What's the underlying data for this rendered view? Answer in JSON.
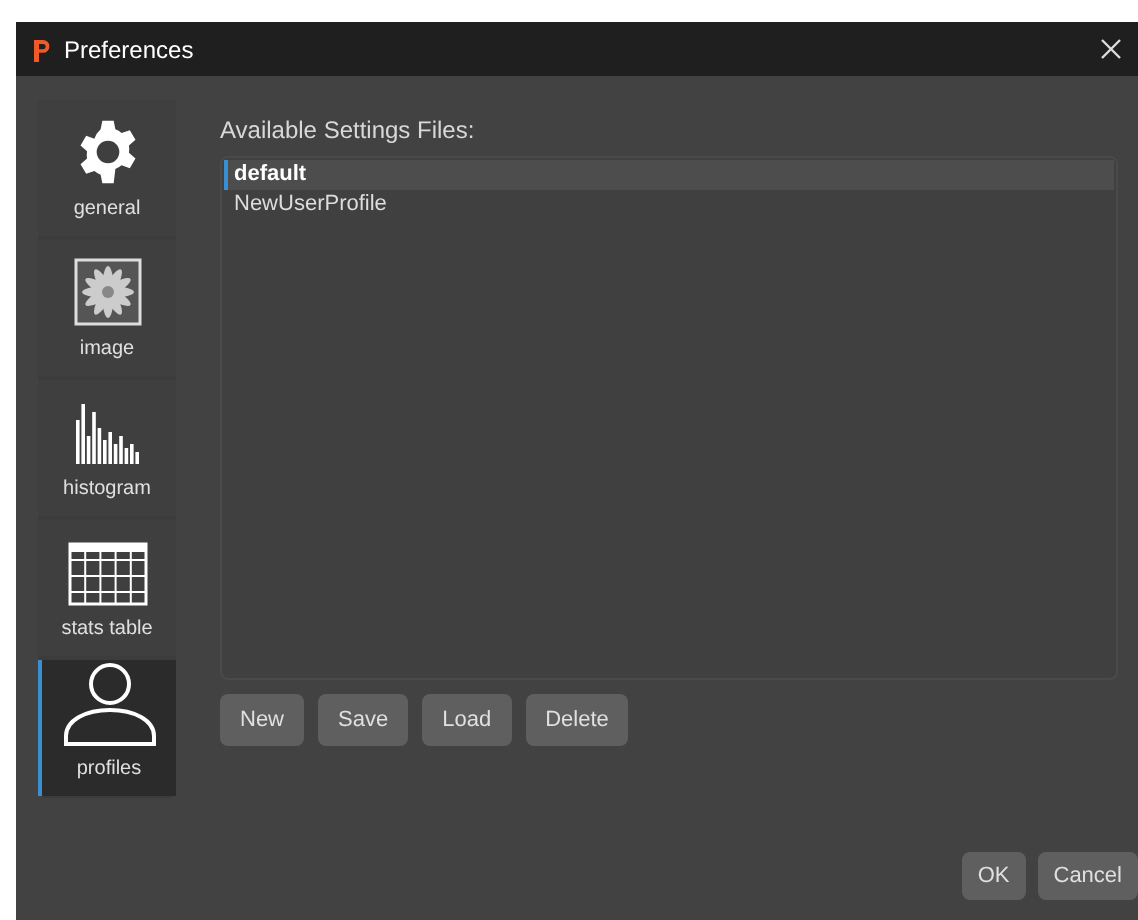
{
  "window": {
    "title": "Preferences"
  },
  "sidebar": {
    "items": [
      {
        "label": "general",
        "kind": "gear",
        "selected": false
      },
      {
        "label": "image",
        "kind": "image",
        "selected": false
      },
      {
        "label": "histogram",
        "kind": "histogram",
        "selected": false
      },
      {
        "label": "stats table",
        "kind": "table",
        "selected": false
      },
      {
        "label": "profiles",
        "kind": "person",
        "selected": true
      }
    ]
  },
  "settings_files": {
    "heading": "Available Settings Files:",
    "items": [
      {
        "label": "default",
        "selected": true
      },
      {
        "label": "NewUserProfile",
        "selected": false
      }
    ]
  },
  "file_buttons": [
    "New",
    "Save",
    "Load",
    "Delete"
  ],
  "dialog_buttons": [
    "OK",
    "Cancel"
  ]
}
